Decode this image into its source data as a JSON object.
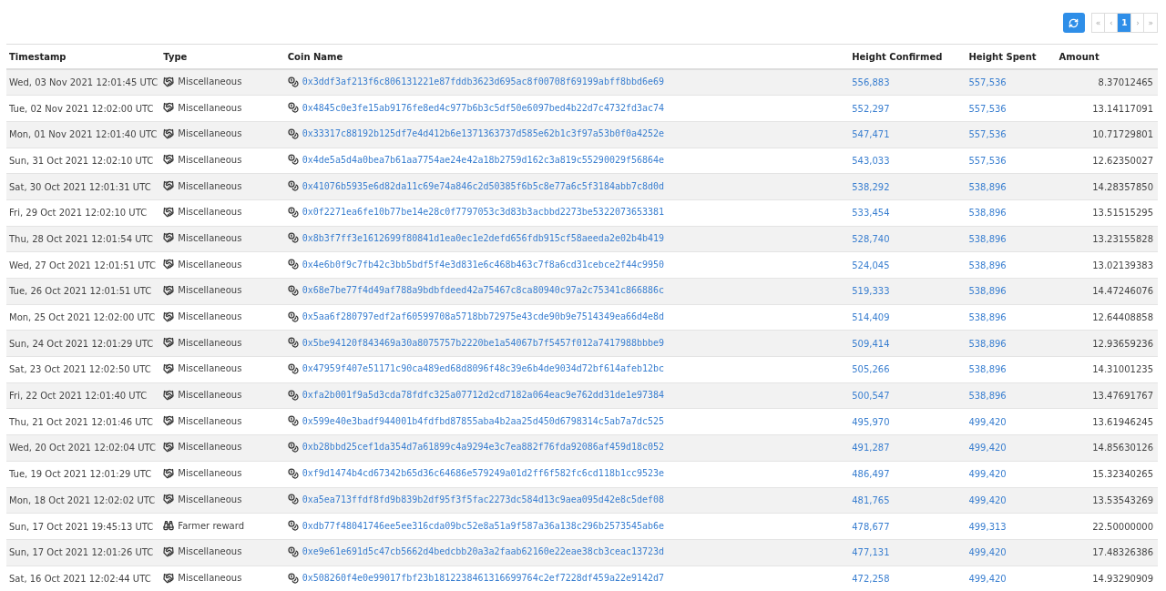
{
  "pagination": {
    "pages": [
      {
        "label": "«",
        "selected": false,
        "disabled": true
      },
      {
        "label": "‹",
        "selected": false,
        "disabled": true
      },
      {
        "label": "1",
        "selected": true,
        "disabled": false
      },
      {
        "label": "›",
        "selected": false,
        "disabled": true
      },
      {
        "label": "»",
        "selected": false,
        "disabled": true
      }
    ]
  },
  "table": {
    "columns": [
      "Timestamp",
      "Type",
      "Coin Name",
      "Height Confirmed",
      "Height Spent",
      "Amount"
    ],
    "rows": [
      {
        "timestamp": "Wed, 03 Nov 2021 12:01:45 UTC",
        "type": {
          "kind": "misc",
          "label": "Miscellaneous"
        },
        "coin": "0x3ddf3af213f6c806131221e87fddb3623d695ac8f00708f69199abff8bbd6e69",
        "confirmed": "556,883",
        "spent": "557,536",
        "amount": "8.37012465"
      },
      {
        "timestamp": "Tue, 02 Nov 2021 12:02:00 UTC",
        "type": {
          "kind": "misc",
          "label": "Miscellaneous"
        },
        "coin": "0x4845c0e3fe15ab9176fe8ed4c977b6b3c5df50e6097bed4b22d7c4732fd3ac74",
        "confirmed": "552,297",
        "spent": "557,536",
        "amount": "13.14117091"
      },
      {
        "timestamp": "Mon, 01 Nov 2021 12:01:40 UTC",
        "type": {
          "kind": "misc",
          "label": "Miscellaneous"
        },
        "coin": "0x33317c88192b125df7e4d412b6e1371363737d585e62b1c3f97a53b0f0a4252e",
        "confirmed": "547,471",
        "spent": "557,536",
        "amount": "10.71729801"
      },
      {
        "timestamp": "Sun, 31 Oct 2021 12:02:10 UTC",
        "type": {
          "kind": "misc",
          "label": "Miscellaneous"
        },
        "coin": "0x4de5a5d4a0bea7b61aa7754ae24e42a18b2759d162c3a819c55290029f56864e",
        "confirmed": "543,033",
        "spent": "557,536",
        "amount": "12.62350027"
      },
      {
        "timestamp": "Sat, 30 Oct 2021 12:01:31 UTC",
        "type": {
          "kind": "misc",
          "label": "Miscellaneous"
        },
        "coin": "0x41076b5935e6d82da11c69e74a846c2d50385f6b5c8e77a6c5f3184abb7c8d0d",
        "confirmed": "538,292",
        "spent": "538,896",
        "amount": "14.28357850"
      },
      {
        "timestamp": "Fri, 29 Oct 2021 12:02:10 UTC",
        "type": {
          "kind": "misc",
          "label": "Miscellaneous"
        },
        "coin": "0x0f2271ea6fe10b77be14e28c0f7797053c3d83b3acbbd2273be5322073653381",
        "confirmed": "533,454",
        "spent": "538,896",
        "amount": "13.51515295"
      },
      {
        "timestamp": "Thu, 28 Oct 2021 12:01:54 UTC",
        "type": {
          "kind": "misc",
          "label": "Miscellaneous"
        },
        "coin": "0x8b3f7ff3e1612699f80841d1ea0ec1e2defd656fdb915cf58aeeda2e02b4b419",
        "confirmed": "528,740",
        "spent": "538,896",
        "amount": "13.23155828"
      },
      {
        "timestamp": "Wed, 27 Oct 2021 12:01:51 UTC",
        "type": {
          "kind": "misc",
          "label": "Miscellaneous"
        },
        "coin": "0x4e6b0f9c7fb42c3bb5bdf5f4e3d831e6c468b463c7f8a6cd31cebce2f44c9950",
        "confirmed": "524,045",
        "spent": "538,896",
        "amount": "13.02139383"
      },
      {
        "timestamp": "Tue, 26 Oct 2021 12:01:51 UTC",
        "type": {
          "kind": "misc",
          "label": "Miscellaneous"
        },
        "coin": "0x68e7be77f4d49af788a9bdbfdeed42a75467c8ca80940c97a2c75341c866886c",
        "confirmed": "519,333",
        "spent": "538,896",
        "amount": "14.47246076"
      },
      {
        "timestamp": "Mon, 25 Oct 2021 12:02:00 UTC",
        "type": {
          "kind": "misc",
          "label": "Miscellaneous"
        },
        "coin": "0x5aa6f280797edf2af60599708a5718bb72975e43cde90b9e7514349ea66d4e8d",
        "confirmed": "514,409",
        "spent": "538,896",
        "amount": "12.64408858"
      },
      {
        "timestamp": "Sun, 24 Oct 2021 12:01:29 UTC",
        "type": {
          "kind": "misc",
          "label": "Miscellaneous"
        },
        "coin": "0x5be94120f843469a30a8075757b2220be1a54067b7f5457f012a7417988bbbe9",
        "confirmed": "509,414",
        "spent": "538,896",
        "amount": "12.93659236"
      },
      {
        "timestamp": "Sat, 23 Oct 2021 12:02:50 UTC",
        "type": {
          "kind": "misc",
          "label": "Miscellaneous"
        },
        "coin": "0x47959f407e51171c90ca489ed68d8096f48c39e6b4de9034d72bf614afeb12bc",
        "confirmed": "505,266",
        "spent": "538,896",
        "amount": "14.31001235"
      },
      {
        "timestamp": "Fri, 22 Oct 2021 12:01:40 UTC",
        "type": {
          "kind": "misc",
          "label": "Miscellaneous"
        },
        "coin": "0xfa2b001f9a5d3cda78fdfc325a07712d2cd7182a064eac9e762dd31de1e97384",
        "confirmed": "500,547",
        "spent": "538,896",
        "amount": "13.47691767"
      },
      {
        "timestamp": "Thu, 21 Oct 2021 12:01:46 UTC",
        "type": {
          "kind": "misc",
          "label": "Miscellaneous"
        },
        "coin": "0x599e40e3badf944001b4fdfbd87855aba4b2aa25d450d6798314c5ab7a7dc525",
        "confirmed": "495,970",
        "spent": "499,420",
        "amount": "13.61946245"
      },
      {
        "timestamp": "Wed, 20 Oct 2021 12:02:04 UTC",
        "type": {
          "kind": "misc",
          "label": "Miscellaneous"
        },
        "coin": "0xb28bbd25cef1da354d7a61899c4a9294e3c7ea882f76fda92086af459d18c052",
        "confirmed": "491,287",
        "spent": "499,420",
        "amount": "14.85630126"
      },
      {
        "timestamp": "Tue, 19 Oct 2021 12:01:29 UTC",
        "type": {
          "kind": "misc",
          "label": "Miscellaneous"
        },
        "coin": "0xf9d1474b4cd67342b65d36c64686e579249a01d2ff6f582fc6cd118b1cc9523e",
        "confirmed": "486,497",
        "spent": "499,420",
        "amount": "15.32340265"
      },
      {
        "timestamp": "Mon, 18 Oct 2021 12:02:02 UTC",
        "type": {
          "kind": "misc",
          "label": "Miscellaneous"
        },
        "coin": "0xa5ea713ffdf8fd9b839b2df95f3f5fac2273dc584d13c9aea095d42e8c5def08",
        "confirmed": "481,765",
        "spent": "499,420",
        "amount": "13.53543269"
      },
      {
        "timestamp": "Sun, 17 Oct 2021 19:45:13 UTC",
        "type": {
          "kind": "farmer",
          "label": "Farmer reward"
        },
        "coin": "0xdb77f48041746ee5ee316cda09bc52e8a51a9f587a36a138c296b2573545ab6e",
        "confirmed": "478,677",
        "spent": "499,313",
        "amount": "22.50000000"
      },
      {
        "timestamp": "Sun, 17 Oct 2021 12:01:26 UTC",
        "type": {
          "kind": "misc",
          "label": "Miscellaneous"
        },
        "coin": "0xe9e61e691d5c47cb5662d4bedcbb20a3a2faab62160e22eae38cb3ceac13723d",
        "confirmed": "477,131",
        "spent": "499,420",
        "amount": "17.48326386"
      },
      {
        "timestamp": "Sat, 16 Oct 2021 12:02:44 UTC",
        "type": {
          "kind": "misc",
          "label": "Miscellaneous"
        },
        "coin": "0x508260f4e0e99017fbf23b1812238461316699764c2ef7228df459a22e9142d7",
        "confirmed": "472,258",
        "spent": "499,420",
        "amount": "14.93290909"
      }
    ]
  }
}
